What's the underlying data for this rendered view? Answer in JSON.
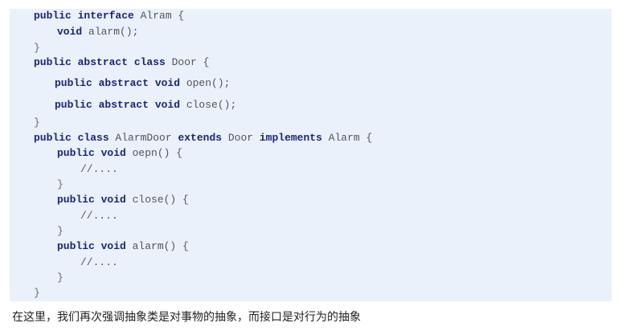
{
  "code": {
    "lines": [
      {
        "segments": [
          {
            "kw": true,
            "text": "public interface"
          },
          {
            "kw": false,
            "text": " Alram {"
          }
        ]
      },
      {
        "segments": [
          {
            "kw": true,
            "text": "void"
          },
          {
            "kw": false,
            "text": " alarm();"
          }
        ]
      },
      {
        "segments": [
          {
            "kw": false,
            "text": "}"
          }
        ]
      },
      {
        "segments": [
          {
            "kw": true,
            "text": "public abstract class"
          },
          {
            "kw": false,
            "text": " Door {"
          }
        ]
      },
      {
        "segments": [
          {
            "kw": true,
            "text": "public abstract void"
          },
          {
            "kw": false,
            "text": " open();"
          }
        ]
      },
      {
        "segments": [
          {
            "kw": true,
            "text": "public abstract void"
          },
          {
            "kw": false,
            "text": " close();"
          }
        ]
      },
      {
        "segments": [
          {
            "kw": false,
            "text": "}"
          }
        ]
      },
      {
        "segments": [
          {
            "kw": true,
            "text": "public class"
          },
          {
            "kw": false,
            "text": " AlarmDoor "
          },
          {
            "kw": true,
            "text": "extends"
          },
          {
            "kw": false,
            "text": " Door "
          },
          {
            "kw": true,
            "text": "implements"
          },
          {
            "kw": false,
            "text": " Alarm {"
          }
        ]
      },
      {
        "segments": [
          {
            "kw": true,
            "text": "public void"
          },
          {
            "kw": false,
            "text": " oepn() {"
          }
        ]
      },
      {
        "segments": [
          {
            "kw": false,
            "text": "//...."
          }
        ]
      },
      {
        "segments": [
          {
            "kw": false,
            "text": "}"
          }
        ]
      },
      {
        "segments": [
          {
            "kw": true,
            "text": "public void"
          },
          {
            "kw": false,
            "text": " close() {"
          }
        ]
      },
      {
        "segments": [
          {
            "kw": false,
            "text": "//...."
          }
        ]
      },
      {
        "segments": [
          {
            "kw": false,
            "text": "}"
          }
        ]
      },
      {
        "segments": [
          {
            "kw": true,
            "text": "public void"
          },
          {
            "kw": false,
            "text": " alarm() {"
          }
        ]
      },
      {
        "segments": [
          {
            "kw": false,
            "text": "//...."
          }
        ]
      },
      {
        "segments": [
          {
            "kw": false,
            "text": "}"
          }
        ]
      },
      {
        "segments": [
          {
            "kw": false,
            "text": "}"
          }
        ]
      }
    ]
  },
  "caption": "在这里，我们再次强调抽象类是对事物的抽象，而接口是对行为的抽象",
  "colors": {
    "code_background": "#eaf1fb",
    "keyword": "#1a237e",
    "code_text": "#555555"
  }
}
